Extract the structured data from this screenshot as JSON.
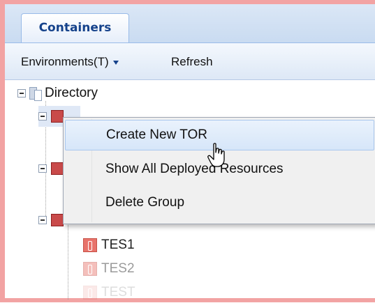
{
  "tabs": [
    {
      "label": "Containers",
      "active": true
    }
  ],
  "toolbar": {
    "environments_label": "Environments(T)",
    "refresh_label": "Refresh"
  },
  "tree": {
    "root_label": "Directory",
    "leaves": [
      "TES1",
      "TES2",
      "TEST"
    ]
  },
  "context_menu": {
    "items": [
      {
        "label": "Create New TOR",
        "hovered": true
      },
      {
        "label": "Show All Deployed Resources"
      },
      {
        "label": "Delete Group"
      }
    ]
  },
  "colors": {
    "border_accent": "#f2a3a3",
    "tab_text": "#15428b",
    "node_icon": "#c94a4a",
    "menu_hover": "#d6e6f9"
  },
  "icons": {
    "toolbar_dropdown": "chevron-down-icon",
    "tree_toggle": "collapse-icon",
    "tree_root": "folder-icon",
    "tree_group": "group-icon",
    "tree_leaf": "resource-icon",
    "cursor": "hand-pointer-icon"
  }
}
